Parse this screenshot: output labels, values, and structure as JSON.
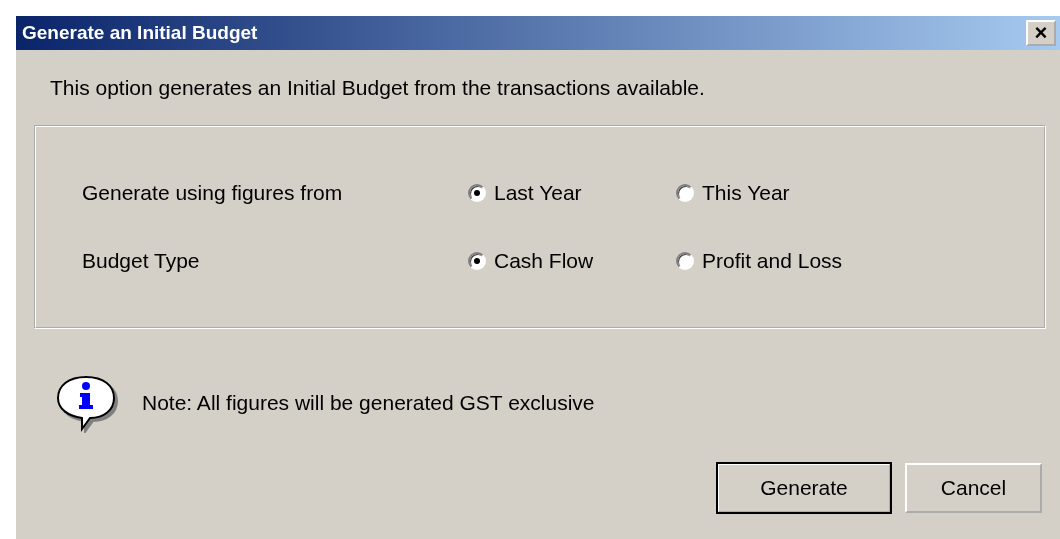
{
  "window": {
    "title": "Generate an Initial Budget",
    "close": "×"
  },
  "intro": "This option generates an Initial Budget from the transactions available.",
  "options": [
    {
      "label": "Generate using figures from",
      "choices": [
        {
          "label": "Last Year",
          "selected": true
        },
        {
          "label": "This Year",
          "selected": false
        }
      ]
    },
    {
      "label": "Budget Type",
      "choices": [
        {
          "label": "Cash Flow",
          "selected": true
        },
        {
          "label": "Profit and Loss",
          "selected": false
        }
      ]
    }
  ],
  "note": "Note: All figures will be generated GST exclusive",
  "buttons": [
    {
      "label": "Generate",
      "default": true
    },
    {
      "label": "Cancel",
      "default": false
    }
  ]
}
